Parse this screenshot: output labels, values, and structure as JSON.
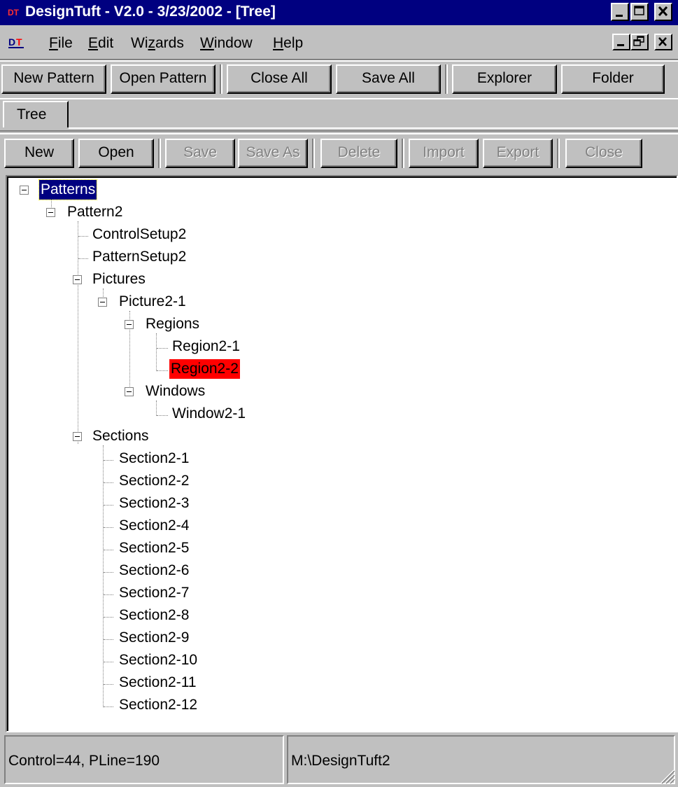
{
  "window": {
    "title": "DesignTuft - V2.0 - 3/23/2002 - [Tree]",
    "colors": {
      "titlebar": "#000080",
      "face": "#c0c0c0",
      "selected_red": "#ff0000"
    }
  },
  "menu": {
    "app_icon": "DT",
    "items": [
      {
        "label": "File",
        "mnemonic": "F",
        "rest": "ile"
      },
      {
        "label": "Edit",
        "mnemonic": "E",
        "rest": "dit"
      },
      {
        "label": "Wizards",
        "pre": "Wi",
        "mnemonic": "z",
        "rest": "ards"
      },
      {
        "label": "Window",
        "mnemonic": "W",
        "rest": "indow"
      },
      {
        "label": "Help",
        "mnemonic": "H",
        "rest": "elp"
      }
    ]
  },
  "toolbar_main": {
    "new_pattern": "New Pattern",
    "open_pattern": "Open Pattern",
    "close_all": "Close All",
    "save_all": "Save All",
    "explorer": "Explorer",
    "folder": "Folder"
  },
  "tabs": {
    "tree": "Tree"
  },
  "toolbar_tree": {
    "new": "New",
    "open": "Open",
    "save": "Save",
    "save_as": "Save As",
    "delete": "Delete",
    "import": "Import",
    "export": "Export",
    "close": "Close"
  },
  "tree": {
    "root": "Patterns",
    "pattern": "Pattern2",
    "control_setup": "ControlSetup2",
    "pattern_setup": "PatternSetup2",
    "pictures": "Pictures",
    "picture": "Picture2-1",
    "regions": "Regions",
    "region1": "Region2-1",
    "region2": "Region2-2",
    "windows": "Windows",
    "window1": "Window2-1",
    "sections": "Sections",
    "section_items": [
      "Section2-1",
      "Section2-2",
      "Section2-3",
      "Section2-4",
      "Section2-5",
      "Section2-6",
      "Section2-7",
      "Section2-8",
      "Section2-9",
      "Section2-10",
      "Section2-11",
      "Section2-12"
    ]
  },
  "status": {
    "left": "Control=44, PLine=190",
    "right": "M:\\DesignTuft2"
  }
}
